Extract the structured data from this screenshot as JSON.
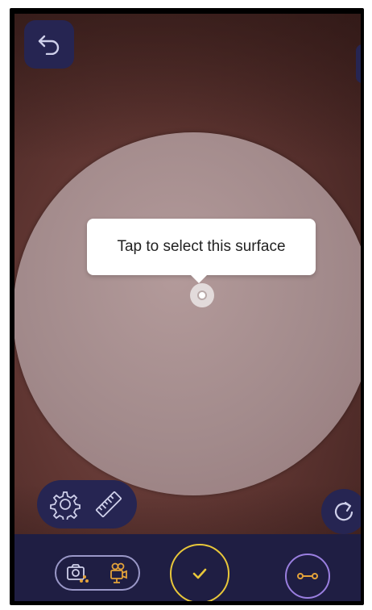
{
  "tooltip": {
    "text": "Tap to select this surface"
  },
  "icons": {
    "back": "undo-arrow-icon",
    "settings": "gear-icon",
    "ruler": "ruler-icon",
    "refresh": "refresh-icon",
    "camera_share": "camera-share-icon",
    "video": "video-camera-icon",
    "confirm": "checkmark-icon",
    "measure": "measure-line-icon"
  },
  "colors": {
    "panel": "#262552",
    "bottom_bar": "#1f1e43",
    "accent_yellow": "#e8c73a",
    "accent_orange": "#e3a23a",
    "accent_purple": "#9a7fe0",
    "icon_light": "#cfd0ea"
  }
}
